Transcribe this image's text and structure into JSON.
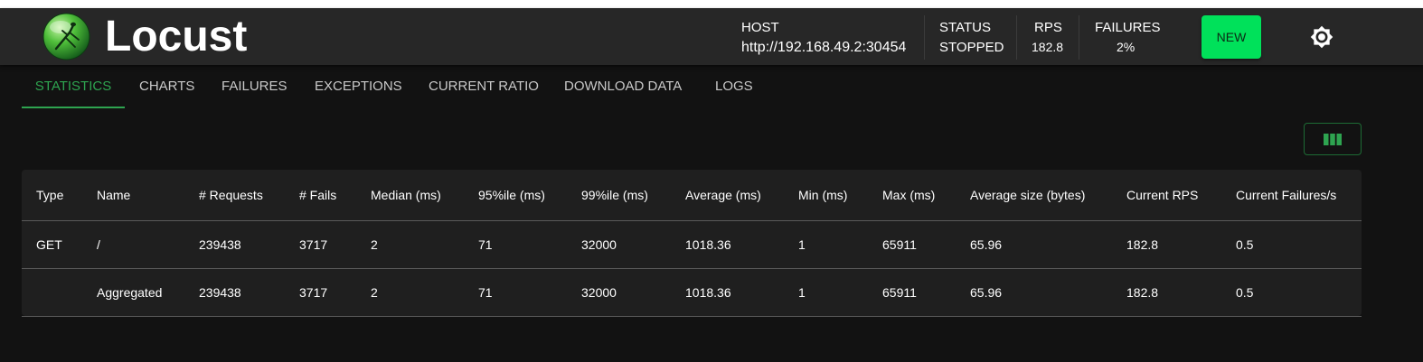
{
  "app": {
    "title": "Locust"
  },
  "header": {
    "host": {
      "label": "HOST",
      "value": "http://192.168.49.2:30454"
    },
    "status": {
      "label": "STATUS",
      "value": "STOPPED"
    },
    "rps": {
      "label": "RPS",
      "value": "182.8"
    },
    "failures": {
      "label": "FAILURES",
      "value": "2%"
    },
    "new_label": "NEW"
  },
  "tabs": [
    {
      "label": "STATISTICS"
    },
    {
      "label": "CHARTS"
    },
    {
      "label": "FAILURES"
    },
    {
      "label": "EXCEPTIONS"
    },
    {
      "label": "CURRENT RATIO"
    },
    {
      "label": "DOWNLOAD DATA"
    },
    {
      "label": "LOGS"
    }
  ],
  "table": {
    "headers": [
      "Type",
      "Name",
      "# Requests",
      "# Fails",
      "Median (ms)",
      "95%ile (ms)",
      "99%ile (ms)",
      "Average (ms)",
      "Min (ms)",
      "Max (ms)",
      "Average size (bytes)",
      "Current RPS",
      "Current Failures/s"
    ],
    "rows": [
      [
        "GET",
        "/",
        "239438",
        "3717",
        "2",
        "71",
        "32000",
        "1018.36",
        "1",
        "65911",
        "65.96",
        "182.8",
        "0.5"
      ],
      [
        "",
        "Aggregated",
        "239438",
        "3717",
        "2",
        "71",
        "32000",
        "1018.36",
        "1",
        "65911",
        "65.96",
        "182.8",
        "0.5"
      ]
    ]
  },
  "colors": {
    "accent": "#2ea450",
    "new_button": "#00e15a",
    "header_bg": "#272727",
    "page_bg": "#121212",
    "table_bg": "#1f1f1f"
  },
  "icons": {
    "logo": "locust-logo-icon",
    "theme": "brightness-icon",
    "columns": "view-column-icon"
  }
}
